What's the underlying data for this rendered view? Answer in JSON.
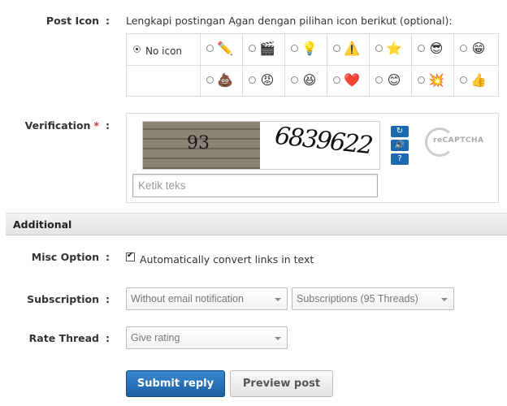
{
  "post_icon": {
    "label": "Post Icon",
    "colon": ":",
    "intro": "Lengkapi postingan Agan dengan pilihan icon berikut (optional):",
    "no_icon_label": "No icon",
    "row1": [
      {
        "name": "pencil-icon",
        "glyph": "✏️"
      },
      {
        "name": "clapperboard-icon",
        "glyph": "🎬"
      },
      {
        "name": "lightbulb-icon",
        "glyph": "💡"
      },
      {
        "name": "warning-icon",
        "glyph": "⚠️"
      },
      {
        "name": "star-icon",
        "glyph": "⭐"
      },
      {
        "name": "cool-face-icon",
        "glyph": "😎"
      },
      {
        "name": "grin-face-icon",
        "glyph": "😁"
      }
    ],
    "row2": [
      {
        "name": "poop-icon",
        "glyph": "💩"
      },
      {
        "name": "angry-face-icon",
        "glyph": "😡"
      },
      {
        "name": "laughing-face-icon",
        "glyph": "😆"
      },
      {
        "name": "heart-icon",
        "glyph": "❤️"
      },
      {
        "name": "blue-face-icon",
        "glyph": "😊"
      },
      {
        "name": "burst-icon",
        "glyph": "💥"
      },
      {
        "name": "thumbs-up-icon",
        "glyph": "👍"
      }
    ]
  },
  "verification": {
    "label": "Verification",
    "required_mark": "*",
    "colon": ":",
    "captcha_text_1": "93",
    "captcha_text_2": "6839622",
    "recaptcha_word": "reCAPTCHA",
    "buttons": [
      {
        "name": "refresh-icon",
        "glyph": "↻"
      },
      {
        "name": "audio-icon",
        "glyph": "🔊"
      },
      {
        "name": "help-icon",
        "glyph": "?"
      }
    ],
    "input_placeholder": "Ketik teks"
  },
  "additional": {
    "title": "Additional"
  },
  "misc_option": {
    "label": "Misc Option",
    "colon": ":",
    "checkbox_label": "Automatically convert links in text",
    "checked": true
  },
  "subscription": {
    "label": "Subscription",
    "colon": ":",
    "select1": "Without email notification",
    "select2": "Subscriptions (95 Threads)"
  },
  "rate_thread": {
    "label": "Rate Thread",
    "colon": ":",
    "select": "Give rating"
  },
  "actions": {
    "submit": "Submit reply",
    "preview": "Preview post"
  },
  "colors": {
    "accent": "#1d69b1",
    "required": "#dd3333"
  }
}
